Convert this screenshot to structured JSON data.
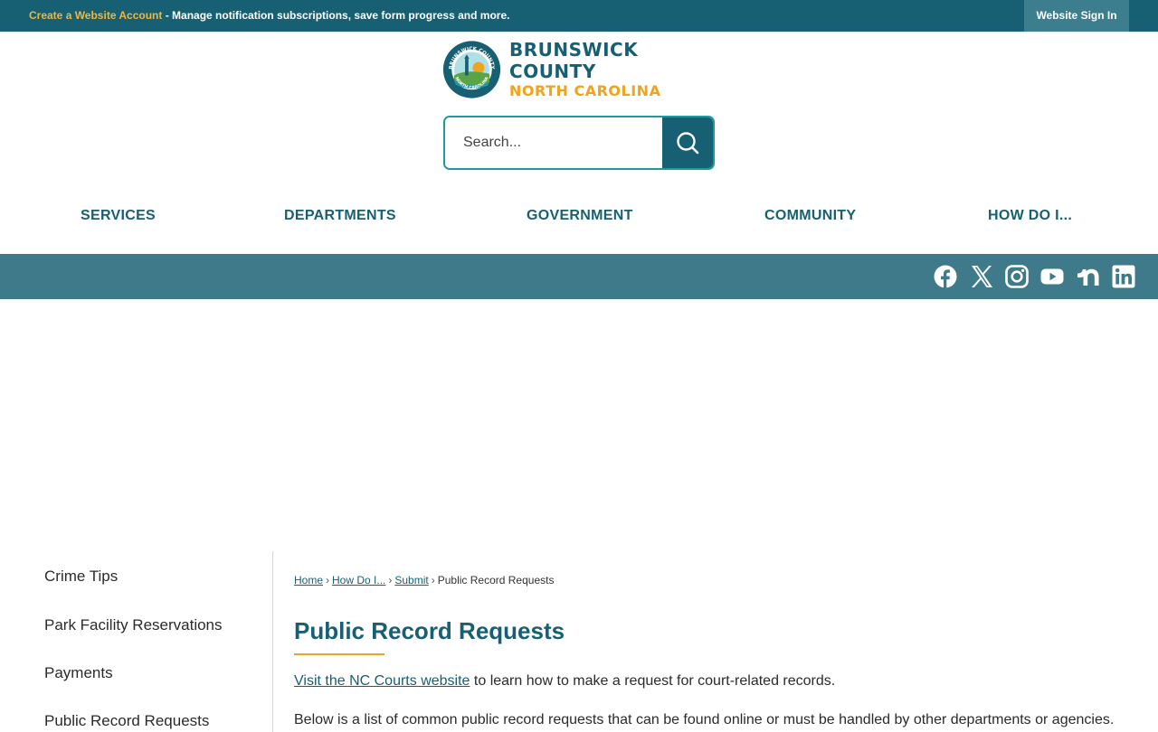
{
  "topbar": {
    "create_link": "Create a Website Account",
    "message": " - Manage notification subscriptions, save form progress and more.",
    "signin_label": "Website Sign In"
  },
  "logo": {
    "line1": "BRUNSWICK COUNTY",
    "line2": "NORTH CAROLINA",
    "seal_top_text": "BRUNSWICK COUNTY",
    "seal_bottom_text": "NORTH CAROLINA"
  },
  "search": {
    "placeholder": "Search...",
    "icon": "search-icon"
  },
  "nav": {
    "items": [
      "SERVICES",
      "DEPARTMENTS",
      "GOVERNMENT",
      "COMMUNITY",
      "HOW DO I..."
    ]
  },
  "social": {
    "icons": [
      "facebook-icon",
      "x-icon",
      "instagram-icon",
      "youtube-icon",
      "nextdoor-icon",
      "linkedin-icon"
    ]
  },
  "sidebar": {
    "items": [
      "Crime Tips",
      "Park Facility Reservations",
      "Payments",
      "Public Record Requests"
    ]
  },
  "breadcrumb": {
    "items": [
      "Home",
      "How Do I...",
      "Submit"
    ],
    "current": "Public Record Requests"
  },
  "content": {
    "title": "Public Record Requests",
    "p1_link": "Visit the NC Courts website",
    "p1_rest": " to learn how to make a request for court-related records.",
    "p2": "Below is a list of common public record requests that can be found online or must be handled by other departments or agencies."
  },
  "colors": {
    "primary": "#175f73",
    "accent": "#f2a31d",
    "social_bar": "#3e7a89",
    "search_border": "#1c9aa0"
  }
}
